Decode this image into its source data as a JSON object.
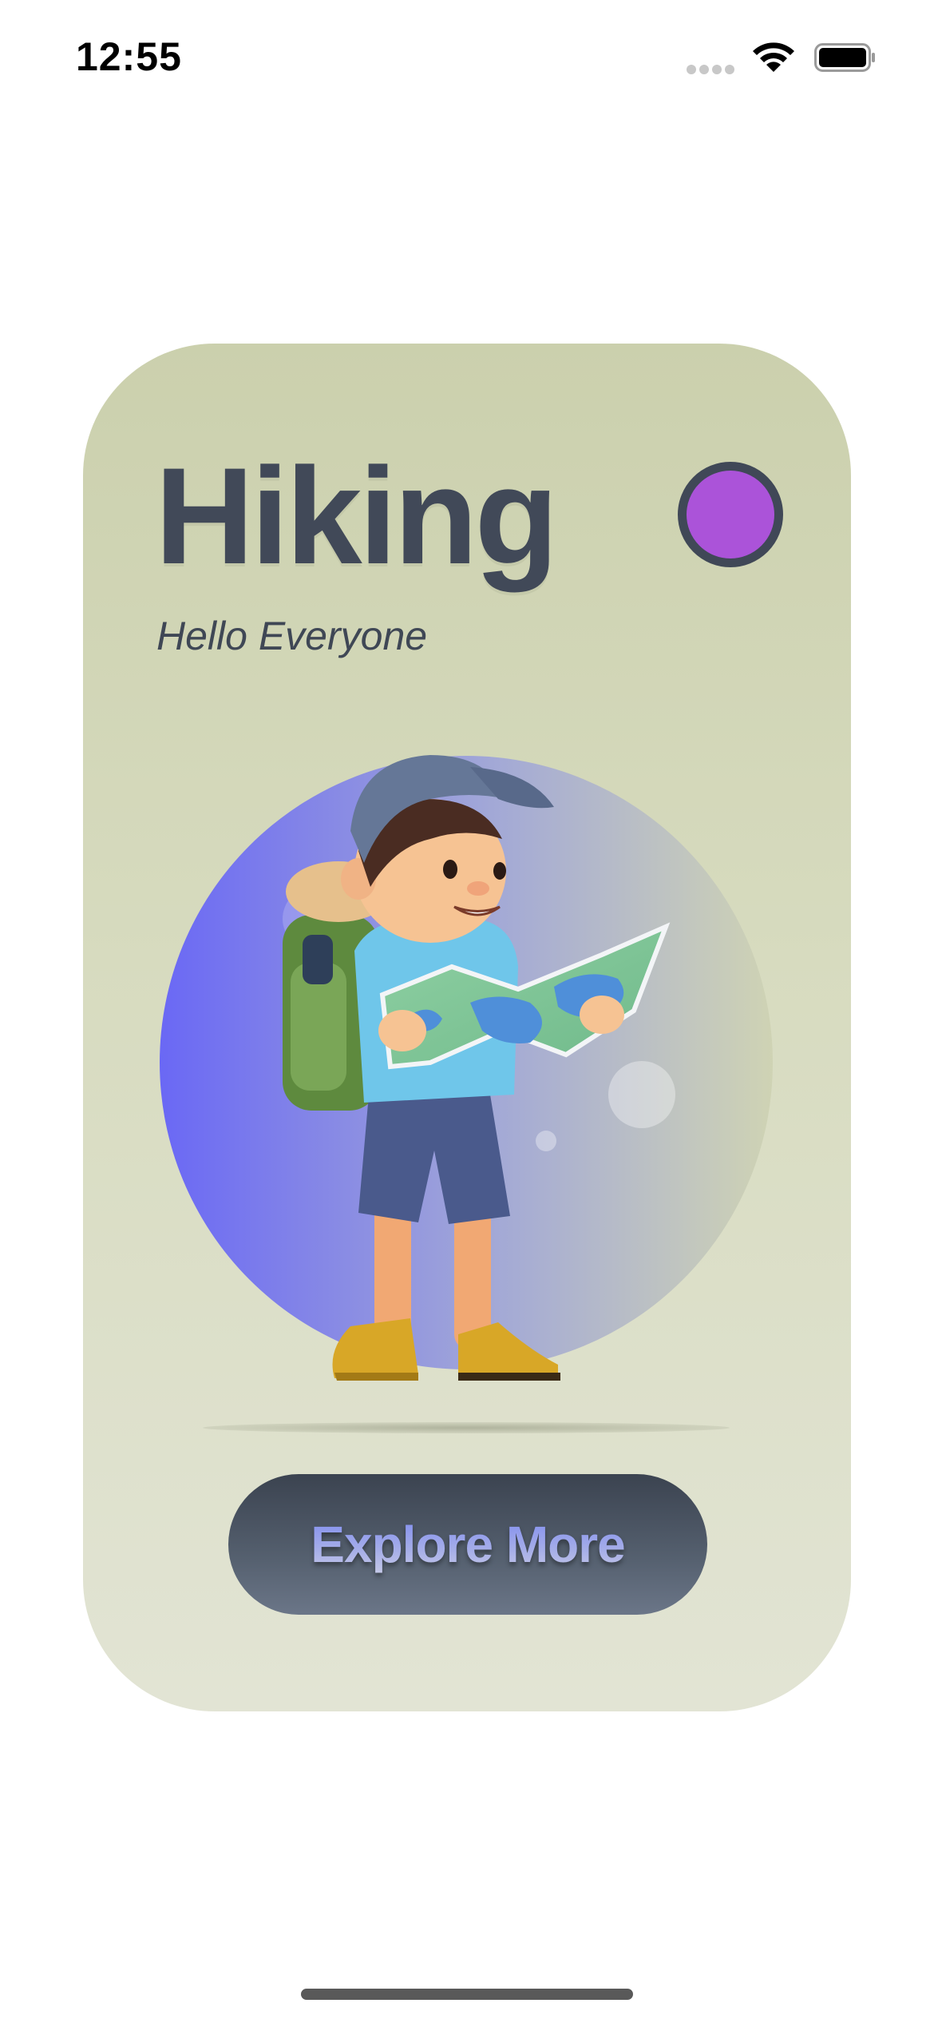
{
  "status_bar": {
    "time": "12:55",
    "icons": [
      "cellular-signal-icon",
      "wifi-icon",
      "battery-icon"
    ]
  },
  "card": {
    "title": "Hiking",
    "subtitle": "Hello Everyone",
    "avatar_color": "#ab53d9",
    "illustration": "hiker-with-map-illustration",
    "button_label": "Explore More"
  },
  "colors": {
    "card_top": "#cbd0ad",
    "card_bottom": "#e2e4d4",
    "title": "#414958",
    "button_dark": "#3b4350",
    "circle_left": "#6a68f5",
    "circle_right": "#cfd3b4"
  }
}
